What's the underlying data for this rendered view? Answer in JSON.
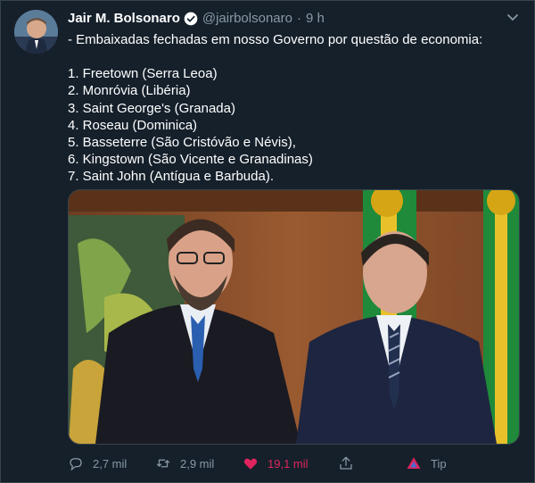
{
  "author": {
    "name": "Jair M. Bolsonaro",
    "handle": "@jairbolsonaro",
    "separator": "·",
    "time": "9 h",
    "verified_icon": "verified-badge-icon"
  },
  "tweet": {
    "intro": "- Embaixadas fechadas em nosso Governo por questão de economia:",
    "items": [
      "1. Freetown (Serra Leoa)",
      "2. Monróvia (Libéria)",
      "3. Saint George's (Granada)",
      "4. Roseau (Dominica)",
      "5. Basseterre (São Cristóvão e Névis),",
      "6. Kingstown (São Vicente e Granadinas)",
      "7. Saint John (Antígua e Barbuda)."
    ]
  },
  "actions": {
    "reply_count": "2,7 mil",
    "retweet_count": "2,9 mil",
    "like_count": "19,1 mil",
    "tip_label": "Tip"
  },
  "colors": {
    "background": "#15202b",
    "muted": "#8899a6",
    "like": "#e0245e",
    "border": "#38444d"
  }
}
